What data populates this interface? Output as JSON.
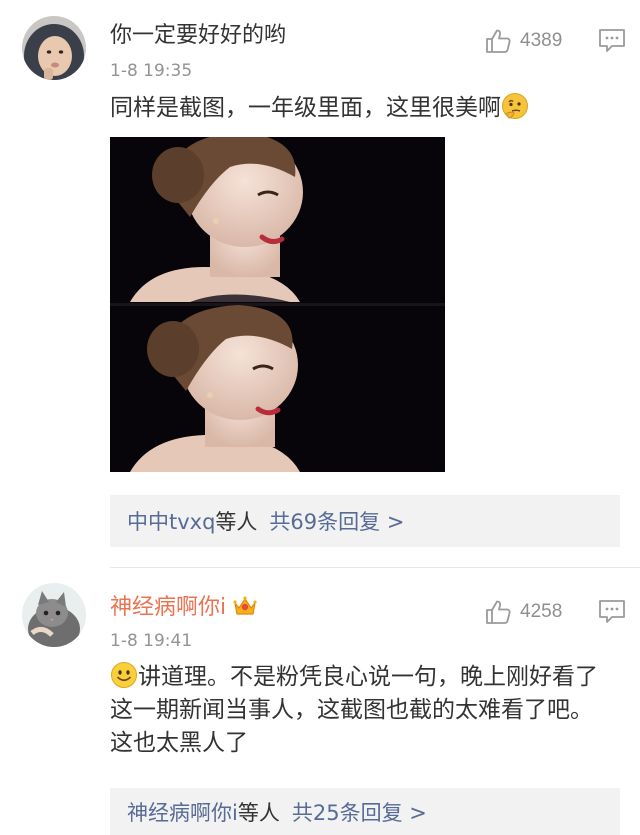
{
  "comments": [
    {
      "username": "你一定要好好的哟",
      "time": "1-8 19:35",
      "likes": "4389",
      "text": "同样是截图，一年级里面，这里很美啊",
      "text_emoji": "thinking-face",
      "image": "two-stacked-screenshots-woman-portrait",
      "replies_who": "中中tvxq",
      "replies_suffix": "等人",
      "replies_total": "共69条回复 >"
    },
    {
      "username": "神经病啊你i",
      "username_badge": "vip-crown-icon",
      "time": "1-8 19:41",
      "likes": "4258",
      "text_emoji": "smiley-face",
      "text": "讲道理。不是粉凭良心说一句，晚上刚好看了这一期新闻当事人，这截图也截的太难看了吧。这也太黑人了",
      "replies_who": "神经病啊你i",
      "replies_suffix": "等人",
      "replies_total": "共25条回复 >"
    }
  ],
  "colors": {
    "link": "#576b95",
    "vip_name": "#eb7350",
    "meta": "#939393",
    "reply_bg": "#f2f2f2"
  }
}
